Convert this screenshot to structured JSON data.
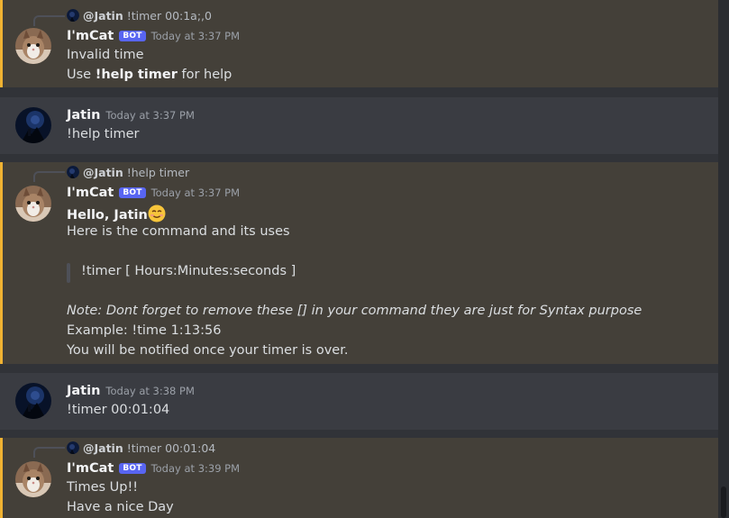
{
  "colors": {
    "mention_bar": "#f0b232",
    "bot_badge": "#5865f2",
    "mention_bg": "#444039",
    "channel_bg": "#313338"
  },
  "messages": [
    {
      "reply_name": "Jatin",
      "reply_text": "!timer 00:1a;,0",
      "author": "I'mCat",
      "badge": "BOT",
      "timestamp": "Today at 3:37 PM",
      "lines": [
        "Invalid time"
      ],
      "help_prefix": "Use ",
      "help_bold": "!help timer",
      "help_suffix": " for help"
    },
    {
      "author": "Jatin",
      "timestamp": "Today at 3:37 PM",
      "lines": [
        "!help timer"
      ]
    },
    {
      "reply_name": "Jatin",
      "reply_text": "!help timer",
      "author": "I'mCat",
      "badge": "BOT",
      "timestamp": "Today at 3:37 PM",
      "greeting": "Hello, Jatin",
      "greeting_emoji": "smiling-face-emoji",
      "intro": "Here is the command and its uses",
      "quote": "!timer [ Hours:Minutes:seconds ]",
      "note": "Note: Dont forget to remove these [] in your command they are just for Syntax purpose",
      "example": "Example: !time 1:13:56",
      "notify": "You will be notified once your timer is over."
    },
    {
      "author": "Jatin",
      "timestamp": "Today at 3:38 PM",
      "lines": [
        "!timer 00:01:04"
      ]
    },
    {
      "reply_name": "Jatin",
      "reply_text": "!timer 00:01:04",
      "author": "I'mCat",
      "badge": "BOT",
      "timestamp": "Today at 3:39 PM",
      "lines": [
        "Times Up!!",
        "Have a nice Day"
      ]
    }
  ]
}
